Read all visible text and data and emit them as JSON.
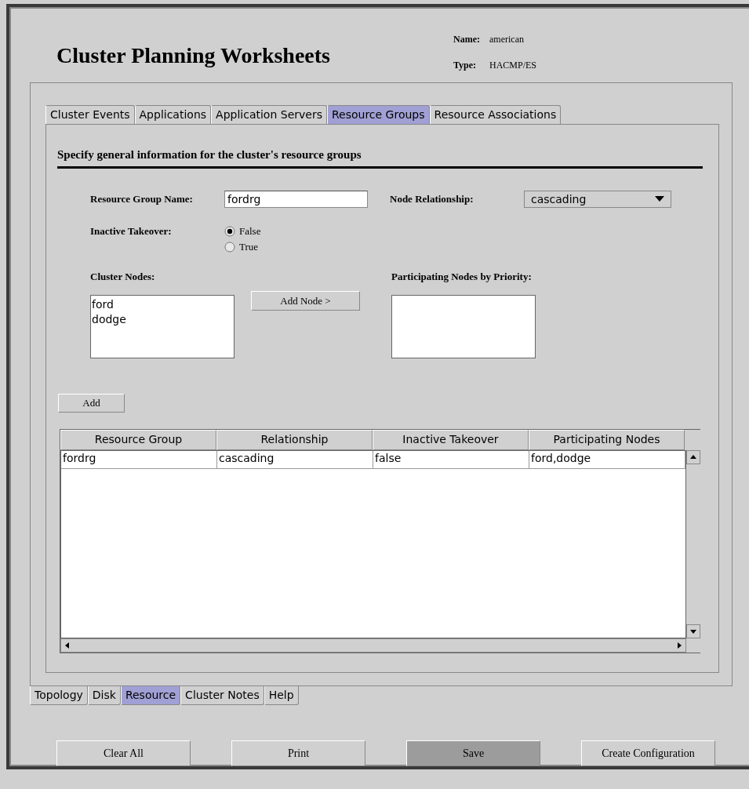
{
  "window": {
    "title": "Cluster Planning Worksheets"
  },
  "info": [
    {
      "label": "Name:",
      "value": "american"
    },
    {
      "label": "Type:",
      "value": "HACMP/ES"
    }
  ],
  "tabs": [
    {
      "label": "Cluster Events",
      "selected": false
    },
    {
      "label": "Applications",
      "selected": false
    },
    {
      "label": "Application Servers",
      "selected": false
    },
    {
      "label": "Resource Groups",
      "selected": true
    },
    {
      "label": "Resource Associations",
      "selected": false
    }
  ],
  "section_heading": "Specify general information for the cluster's resource groups",
  "form": {
    "resource_group_name": {
      "label": "Resource Group Name:",
      "value": "fordrg"
    },
    "node_relationship": {
      "label": "Node Relationship:",
      "value": "cascading"
    },
    "inactive_takeover": {
      "label": "Inactive Takeover:",
      "options": [
        {
          "label": "False",
          "selected": true
        },
        {
          "label": "True",
          "selected": false
        }
      ]
    },
    "cluster_nodes": {
      "label": "Cluster Nodes:",
      "items": [
        "ford",
        "dodge"
      ]
    },
    "add_node_button": "Add Node >",
    "participating_nodes": {
      "label": "Participating Nodes by Priority:"
    }
  },
  "add_button": "Add",
  "table": {
    "columns": [
      "Resource Group",
      "Relationship",
      "Inactive Takeover",
      "Participating Nodes"
    ],
    "rows": [
      [
        "fordrg",
        "cascading",
        "false",
        "ford,dodge"
      ]
    ]
  },
  "bottom_tabs": [
    {
      "label": "Topology",
      "selected": false
    },
    {
      "label": "Disk",
      "selected": false
    },
    {
      "label": "Resource",
      "selected": true
    },
    {
      "label": "Cluster Notes",
      "selected": false
    },
    {
      "label": "Help",
      "selected": false
    }
  ],
  "buttons": [
    {
      "label": "Clear All",
      "pressed": false
    },
    {
      "label": "Print",
      "pressed": false
    },
    {
      "label": "Save",
      "pressed": true
    },
    {
      "label": "Create Configuration",
      "pressed": false
    }
  ]
}
